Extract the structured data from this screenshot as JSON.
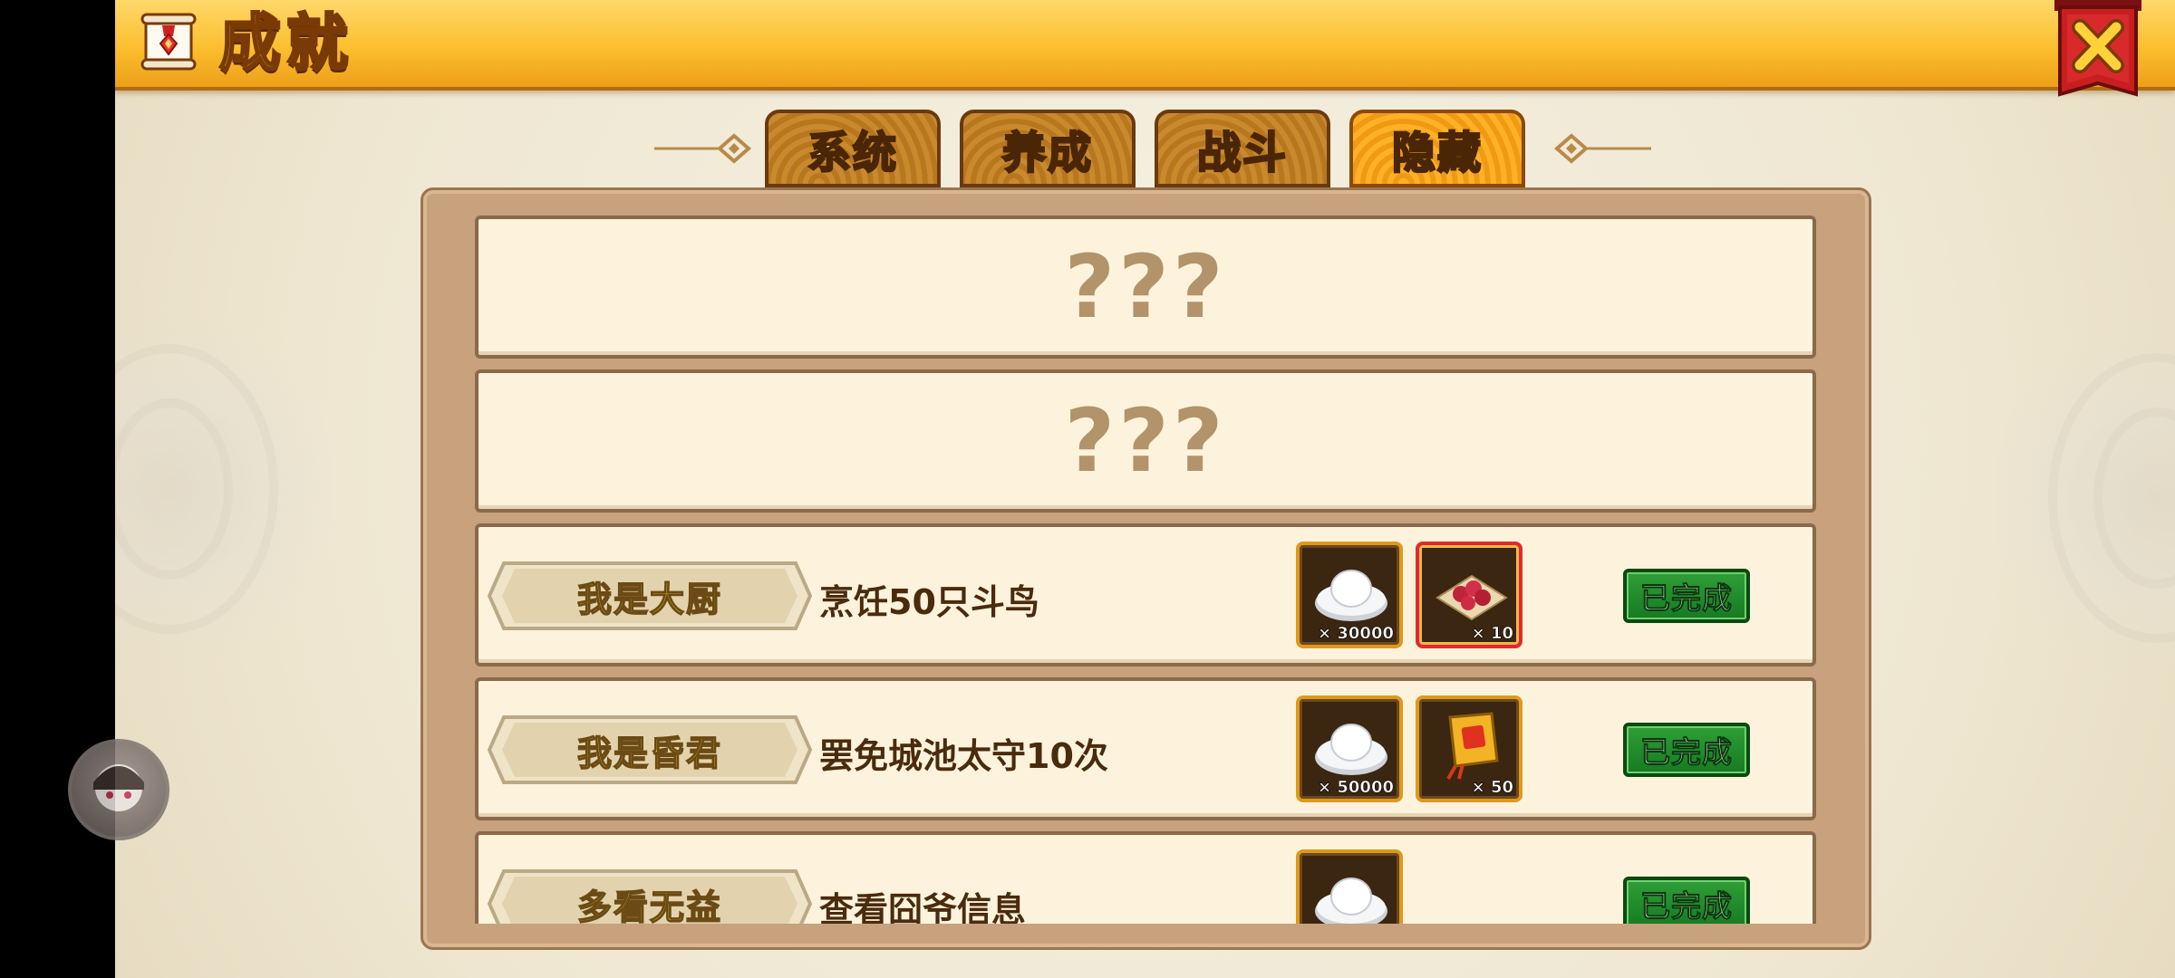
{
  "header": {
    "title": "成就",
    "scroll_icon": "scroll-medal-icon",
    "close_icon": "close-x-icon"
  },
  "tabs": [
    {
      "label": "系统",
      "active": false
    },
    {
      "label": "养成",
      "active": false
    },
    {
      "label": "战斗",
      "active": false
    },
    {
      "label": "隐藏",
      "active": true
    }
  ],
  "achievements": [
    {
      "hidden": true,
      "mask": "???"
    },
    {
      "hidden": true,
      "mask": "???"
    },
    {
      "hidden": false,
      "name": "我是大厨",
      "desc": "烹饪50只斗鸟",
      "rewards": [
        {
          "icon": "silver-ingot-icon",
          "count": "× 30000"
        },
        {
          "icon": "roast-food-platter-icon",
          "count": "× 10"
        }
      ],
      "status": "已完成"
    },
    {
      "hidden": false,
      "name": "我是昏君",
      "desc": "罢免城池太守10次",
      "rewards": [
        {
          "icon": "silver-ingot-icon",
          "count": "× 50000"
        },
        {
          "icon": "decree-token-icon",
          "count": "× 50"
        }
      ],
      "status": "已完成"
    },
    {
      "hidden": false,
      "name": "多看无益",
      "desc": "查看囧爷信息",
      "rewards": [
        {
          "icon": "silver-ingot-icon",
          "count": ""
        }
      ],
      "status": "已完成"
    }
  ],
  "floating_button": {
    "icon": "avatar-assistant-icon"
  },
  "colors": {
    "accent": "#f09a14",
    "done_green": "#1d8a28",
    "name_yellow": "#ffea28"
  }
}
